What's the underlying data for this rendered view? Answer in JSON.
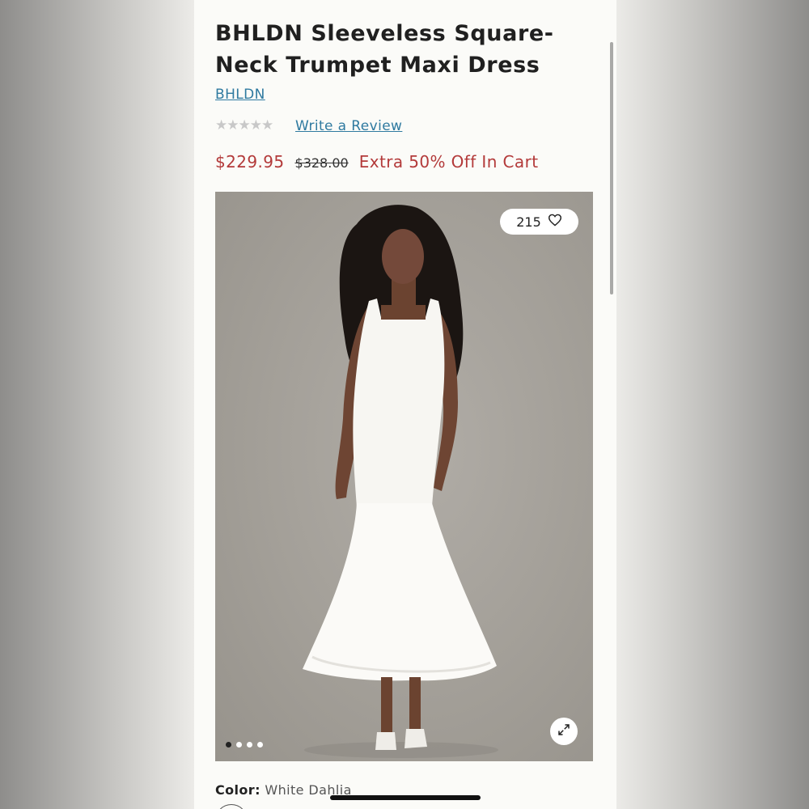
{
  "product": {
    "title": "BHLDN Sleeveless Square-Neck Trumpet Maxi Dress",
    "brand": "BHLDN",
    "rating_stars": "★★★★★",
    "review_link": "Write a Review",
    "price": "$229.95",
    "original_price": "$328.00",
    "promo": "Extra 50% Off In Cart"
  },
  "gallery": {
    "like_count": "215",
    "image_count": 4,
    "active_index": 0
  },
  "color": {
    "label": "Color:",
    "value": "White Dahlia"
  },
  "colors": {
    "accent_link": "#2f7aa0",
    "sale_red": "#b33a3a",
    "background": "#fbfbf8"
  }
}
